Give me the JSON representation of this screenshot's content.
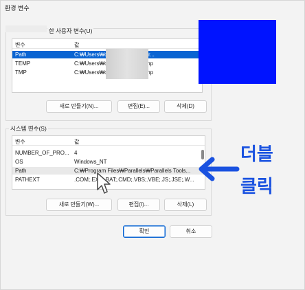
{
  "window": {
    "title": "환경 변수"
  },
  "user_section": {
    "label": "한 사용자 변수(U)",
    "columns": [
      "변수",
      "값"
    ],
    "rows": [
      {
        "name": "Path",
        "value": "C:₩Users₩c                    ata₩Local₩Micr...",
        "selected": true
      },
      {
        "name": "TEMP",
        "value": "C:₩Users₩c                    ata₩Local₩Temp",
        "selected": false
      },
      {
        "name": "TMP",
        "value": "C:₩Users₩c                    ata₩Local₩Temp",
        "selected": false
      }
    ],
    "buttons": {
      "new": "새로 만들기(N)...",
      "edit": "편집(E)...",
      "delete": "삭제(D)"
    }
  },
  "system_section": {
    "label": "시스템 변수(S)",
    "columns": [
      "변수",
      "값"
    ],
    "rows": [
      {
        "name": "NUMBER_OF_PRO...",
        "value": "4"
      },
      {
        "name": "OS",
        "value": "Windows_NT"
      },
      {
        "name": "Path",
        "value": "C:₩Program Files₩Parallels₩Parallels Tools..."
      },
      {
        "name": "PATHEXT",
        "value": ".COM;.EXE;.BAT;.CMD;.VBS;.VBE;.JS;.JSE;.W..."
      }
    ],
    "buttons": {
      "new": "새로 만들기(W)...",
      "edit": "편집(I)...",
      "delete": "삭제(L)"
    }
  },
  "footer": {
    "ok": "확인",
    "cancel": "취소"
  },
  "annotation": {
    "line1": "더블",
    "line2": "클릭"
  },
  "colors": {
    "selection": "#0a64d2",
    "annotation": "#1a52e0",
    "redaction": "#0013ff"
  },
  "icons": [
    "arrow-pointer-icon",
    "mouse-cursor-icon"
  ]
}
